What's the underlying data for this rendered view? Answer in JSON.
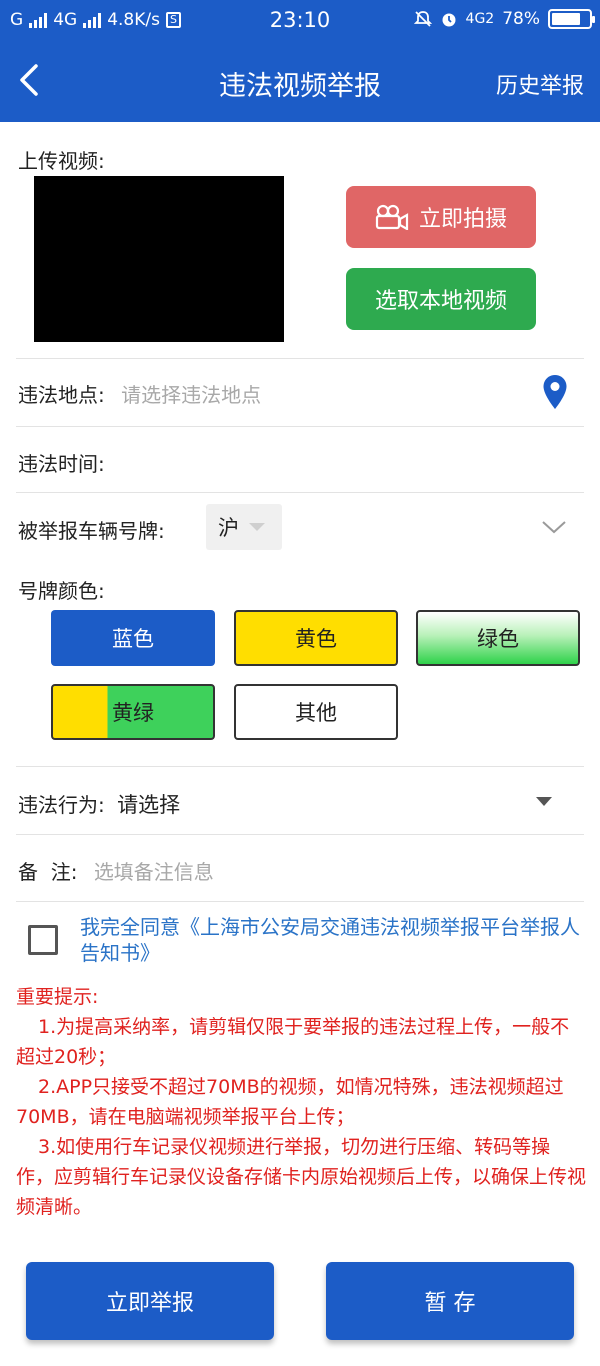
{
  "status": {
    "carrier1": "G",
    "carrier2": "4G",
    "speed": "4.8K/s",
    "s_icon": "S",
    "time": "23:10",
    "net": "4G2",
    "battery": "78%",
    "battery_level": 0.78
  },
  "header": {
    "back_icon": "chevron-left-icon",
    "title": "违法视频举报",
    "history": "历史举报"
  },
  "upload": {
    "label": "上传视频:",
    "shoot_button": "立即拍摄",
    "shoot_icon": "video-camera-icon",
    "local_button": "选取本地视频"
  },
  "location": {
    "label": "违法地点:",
    "placeholder": "请选择违法地点",
    "icon": "location-pin-icon"
  },
  "time": {
    "label": "违法时间:"
  },
  "plate": {
    "label": "被举报车辆号牌:",
    "province": "沪",
    "expand_icon": "chevron-down-icon"
  },
  "plate_color": {
    "label": "号牌颜色:",
    "options": [
      "蓝色",
      "黄色",
      "绿色",
      "黄绿",
      "其他"
    ]
  },
  "behavior": {
    "label": "违法行为:",
    "value": "请选择",
    "icon": "triangle-down-icon"
  },
  "remark": {
    "label": "备  注:",
    "placeholder": "选填备注信息"
  },
  "agreement": {
    "text": "我完全同意《上海市公安局交通违法视频举报平台举报人告知书》"
  },
  "notice": {
    "title": "重要提示:",
    "items": [
      "1.为提高采纳率，请剪辑仅限于要举报的违法过程上传，一般不超过20秒；",
      "2.APP只接受不超过70MB的视频，如情况特殊，违法视频超过70MB，请在电脑端视频举报平台上传；",
      "3.如使用行车记录仪视频进行举报，切勿进行压缩、转码等操作，应剪辑行车记录仪设备存储卡内原始视频后上传，以确保上传视频清晰。"
    ]
  },
  "buttons": {
    "report": "立即举报",
    "save": "暂 存"
  },
  "colors": {
    "primary": "#1c5cc7",
    "shoot": "#e06666",
    "local": "#2eaa4f",
    "warning": "#e0221f",
    "link": "#2a73c7"
  }
}
